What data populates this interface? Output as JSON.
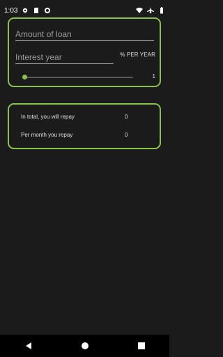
{
  "status_bar": {
    "time": "1:03",
    "icons_left": [
      "settings-icon",
      "sd-card-icon",
      "vpn-icon"
    ],
    "icons_right": [
      "wifi-icon",
      "airplane-icon",
      "battery-icon"
    ]
  },
  "loan_form": {
    "amount_placeholder": "Amount of loan",
    "interest_placeholder": "Interest year",
    "unit_label": "% PER YEAR",
    "years_slider_value": 1,
    "years_value_text": "1"
  },
  "results": {
    "total_label": "In total, you will repay",
    "total_value": "0",
    "monthly_label": "Per month you repay",
    "monthly_value": "0"
  },
  "colors": {
    "accent": "#8bc34a",
    "background": "#1b1b1b"
  },
  "nav_bar": {
    "buttons": [
      "back-icon",
      "home-icon",
      "recents-icon"
    ]
  }
}
